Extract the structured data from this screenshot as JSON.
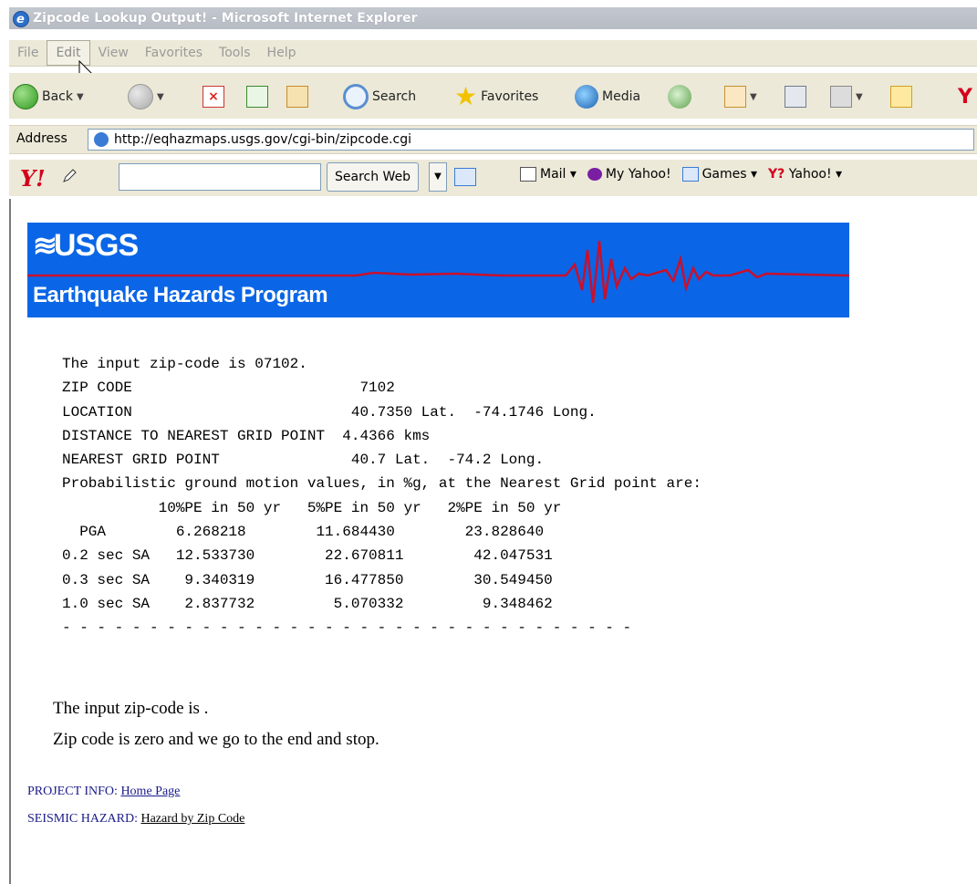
{
  "window": {
    "title": "Zipcode Lookup Output! - Microsoft Internet Explorer"
  },
  "menu": [
    "File",
    "Edit",
    "View",
    "Favorites",
    "Tools",
    "Help"
  ],
  "toolbar": {
    "back_label": "Back",
    "search_label": "Search",
    "favorites_label": "Favorites",
    "media_label": "Media"
  },
  "address": {
    "label": "Address",
    "url": "http://eqhazmaps.usgs.gov/cgi-bin/zipcode.cgi"
  },
  "yahoo_toolbar": {
    "logo": "Y!",
    "search_button": "Search Web",
    "links": [
      "Mail",
      "My Yahoo!",
      "Games",
      "Yahoo!"
    ]
  },
  "banner": {
    "logo_text": "USGS",
    "program_text": "Earthquake Hazards Program"
  },
  "output": {
    "lines": [
      "The input zip-code is 07102.",
      "ZIP CODE                          7102",
      "LOCATION                         40.7350 Lat.  -74.1746 Long.",
      "DISTANCE TO NEAREST GRID POINT  4.4366 kms",
      "NEAREST GRID POINT               40.7 Lat.  -74.2 Long.",
      "Probabilistic ground motion values, in %g, at the Nearest Grid point are:",
      "           10%PE in 50 yr   5%PE in 50 yr   2%PE in 50 yr",
      "  PGA        6.268218        11.684430        23.828640",
      "0.2 sec SA   12.533730        22.670811        42.047531",
      "0.3 sec SA    9.340319        16.477850        30.549450",
      "1.0 sec SA    2.837732         5.070332         9.348462",
      "- - - - - - - - - - - - - - - - - - - - - - - - - - - - - - - - -"
    ]
  },
  "messages": [
    "The input zip-code is .",
    "Zip code is zero and we go to the end and stop."
  ],
  "footer": {
    "project_label": "PROJECT INFO:",
    "project_link": "Home Page",
    "hazard_label": "SEISMIC HAZARD:",
    "hazard_link": "Hazard by Zip Code"
  }
}
